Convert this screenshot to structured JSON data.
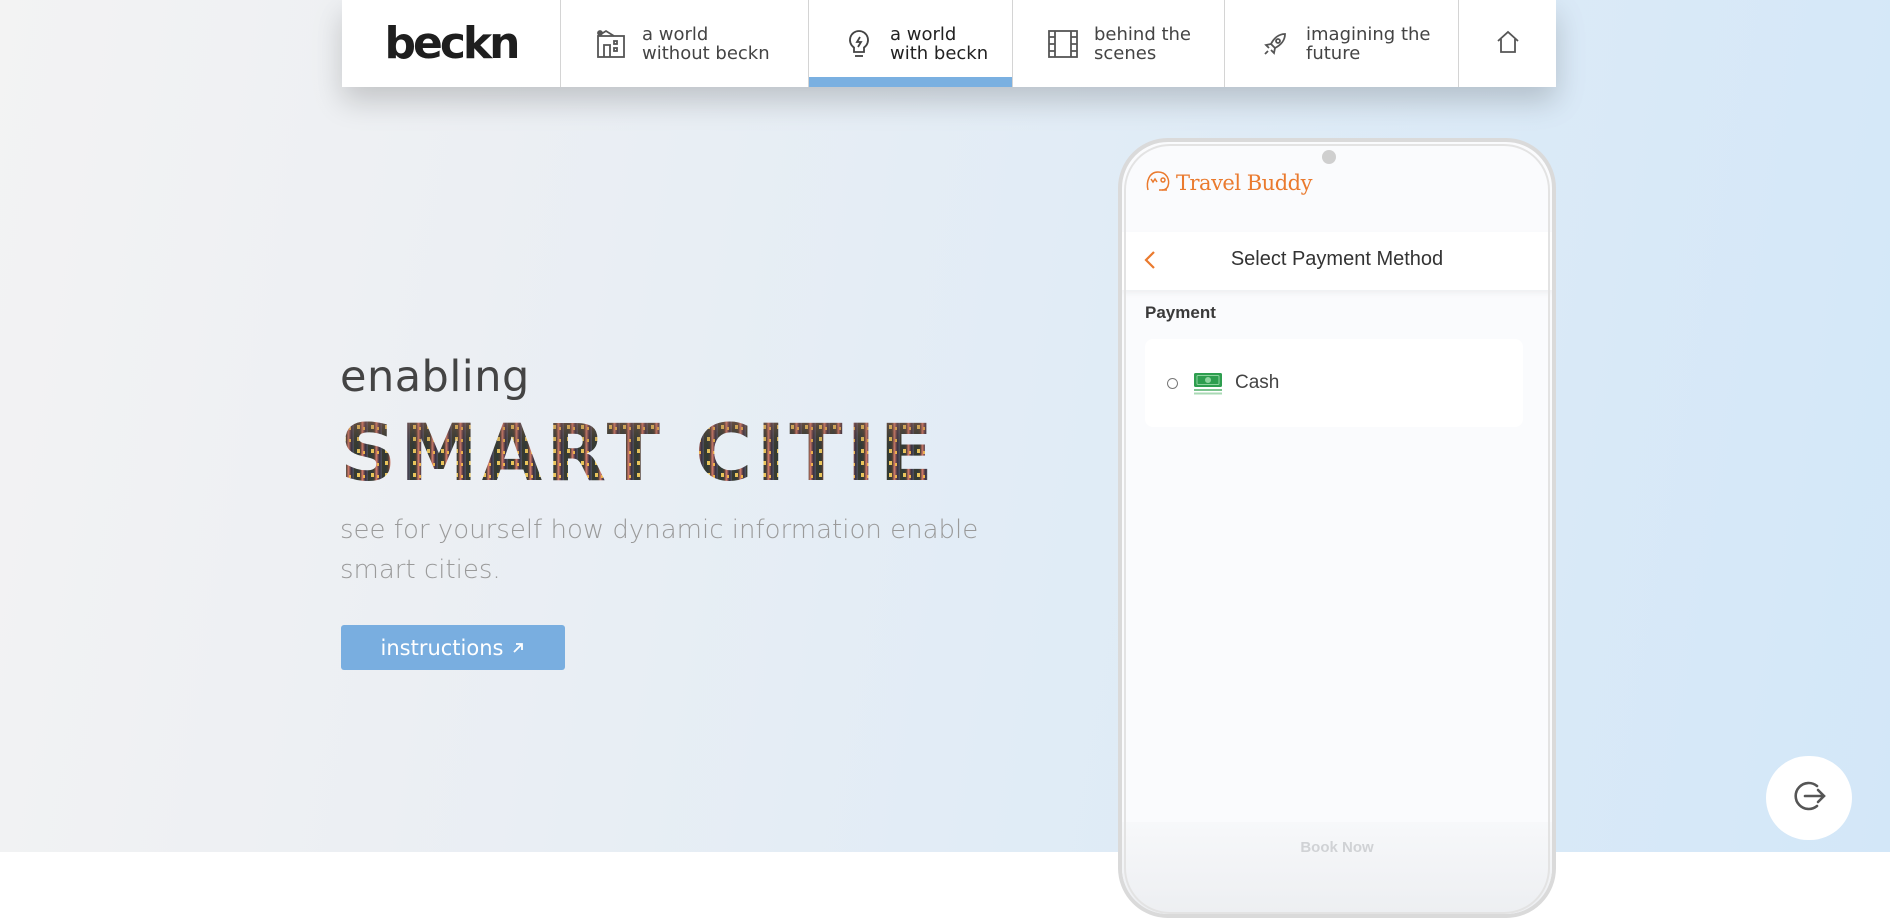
{
  "nav": {
    "logo": "beckn",
    "items": [
      {
        "label": "a world\nwithout beckn",
        "icon": "building-icon",
        "active": false
      },
      {
        "label": "a world\nwith beckn",
        "icon": "lightbulb-icon",
        "active": true
      },
      {
        "label": "behind the\nscenes",
        "icon": "film-icon",
        "active": false
      },
      {
        "label": "imagining the\nfuture",
        "icon": "rocket-icon",
        "active": false
      }
    ],
    "home_icon": "home-icon"
  },
  "hero": {
    "eyebrow": "enabling",
    "headline": "SMART CITIES",
    "description": "see for yourself how dynamic information enable smart cities.",
    "button_label": "instructions",
    "button_icon": "arrow-up-right-icon"
  },
  "phone": {
    "brand": "Travel Buddy",
    "title": "Select Payment Method",
    "section_label": "Payment",
    "payment_option": "Cash",
    "cta_label": "Book Now"
  },
  "colors": {
    "accent_blue": "#79aee0",
    "brand_orange": "#ea7a2e",
    "cash_green": "#2e9e4f"
  },
  "exit_icon": "logout-icon"
}
